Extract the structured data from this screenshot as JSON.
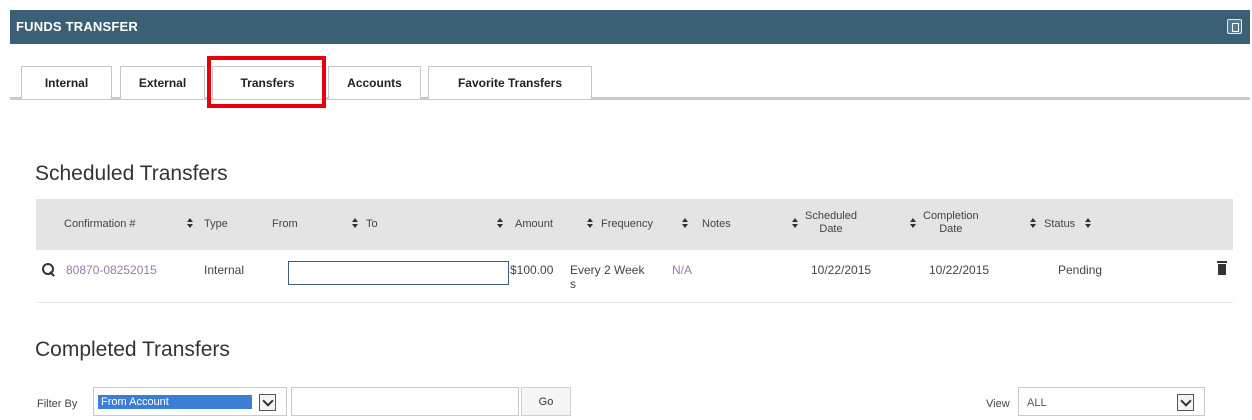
{
  "header": {
    "title": "FUNDS TRANSFER",
    "icon": "popout-icon"
  },
  "tabs": [
    {
      "label": "Internal"
    },
    {
      "label": "External"
    },
    {
      "label": "Transfers"
    },
    {
      "label": "Accounts"
    },
    {
      "label": "Favorite Transfers"
    }
  ],
  "active_tab": "Transfers",
  "highlight_color": "#e8000c",
  "scheduled": {
    "title": "Scheduled Transfers",
    "columns": {
      "confirmation": "Confirmation #",
      "type": "Type",
      "from": "From",
      "to": "To",
      "amount": "Amount",
      "frequency": "Frequency",
      "notes": "Notes",
      "scheduled_line1": "Scheduled",
      "scheduled_line2": "Date",
      "completion_line1": "Completion",
      "completion_line2": "Date",
      "status": "Status"
    },
    "rows": [
      {
        "confirmation": "80870-08252015",
        "type": "Internal",
        "from": "",
        "to": "",
        "amount": "$100.00",
        "frequency_line1": "Every 2 Week",
        "frequency_line2": "s",
        "notes": "N/A",
        "scheduled_date": "10/22/2015",
        "completion_date": "10/22/2015",
        "status": "Pending"
      }
    ]
  },
  "completed": {
    "title": "Completed Transfers",
    "filter_label": "Filter By",
    "filter_selected": "From Account",
    "filter_value": "",
    "go_label": "Go",
    "view_label": "View",
    "view_selected": "ALL"
  },
  "colors": {
    "header_bg": "#3b5f74",
    "link": "#9a79ad",
    "selection": "#3a7fd5"
  }
}
